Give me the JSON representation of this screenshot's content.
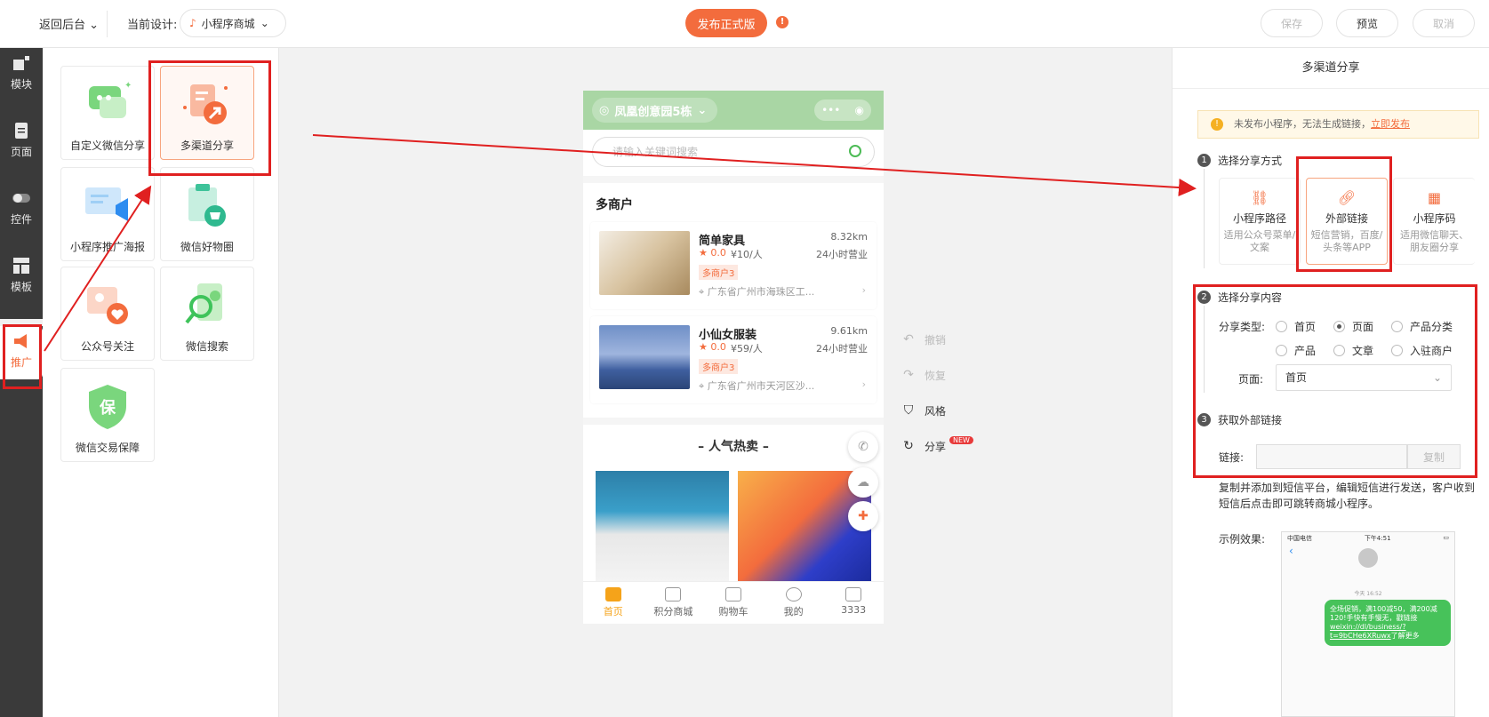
{
  "topbar": {
    "back_label": "返回后台",
    "current_label": "当前设计:",
    "design_name": "小程序商城",
    "publish_label": "发布正式版",
    "warning_icon": "exclamation-icon",
    "save_label": "保存",
    "preview_label": "预览",
    "cancel_label": "取消"
  },
  "rail": {
    "items": [
      {
        "label": "模块",
        "icon": "module-icon"
      },
      {
        "label": "页面",
        "icon": "page-icon"
      },
      {
        "label": "控件",
        "icon": "toggle-icon"
      },
      {
        "label": "模板",
        "icon": "template-icon"
      },
      {
        "label": "推广",
        "icon": "megaphone-icon"
      }
    ]
  },
  "widgets": [
    {
      "label": "自定义微信分享",
      "icon": "wechat-chat-icon"
    },
    {
      "label": "多渠道分享",
      "icon": "share-arrow-icon"
    },
    {
      "label": "小程序推广海报",
      "icon": "poster-icon"
    },
    {
      "label": "微信好物圈",
      "icon": "cart-bag-icon"
    },
    {
      "label": "公众号关注",
      "icon": "heart-follow-icon"
    },
    {
      "label": "微信搜索",
      "icon": "search-icon"
    },
    {
      "label": "微信交易保障",
      "icon": "shield-icon"
    }
  ],
  "phone": {
    "location": "凤凰创意园5栋",
    "search_placeholder": "请输入关键词搜索",
    "section_title": "多商户",
    "shops": [
      {
        "name": "简单家具",
        "distance": "8.32km",
        "rating": "0.0",
        "price": "¥10/人",
        "hours": "24小时营业",
        "tag": "多商户3",
        "address": "广东省广州市海珠区工..."
      },
      {
        "name": "小仙女服装",
        "distance": "9.61km",
        "rating": "0.0",
        "price": "¥59/人",
        "hours": "24小时营业",
        "tag": "多商户3",
        "address": "广东省广州市天河区沙..."
      }
    ],
    "hot_title": "– 人气热卖 –",
    "tabs": [
      {
        "label": "首页"
      },
      {
        "label": "积分商城"
      },
      {
        "label": "购物车"
      },
      {
        "label": "我的"
      },
      {
        "label": "3333"
      }
    ]
  },
  "side_tools": {
    "undo": "撤销",
    "redo": "恢复",
    "style": "风格",
    "share": "分享",
    "new_badge": "NEW"
  },
  "right_panel": {
    "title": "多渠道分享",
    "notice": "未发布小程序，无法生成链接，",
    "notice_link": "立即发布",
    "step1": {
      "num": "1",
      "label": "选择分享方式"
    },
    "methods": [
      {
        "title": "小程序路径",
        "desc": "适用公众号菜单/文案",
        "icon": "path-icon"
      },
      {
        "title": "外部链接",
        "desc": "短信营销，百度/头条等APP",
        "icon": "link-icon"
      },
      {
        "title": "小程序码",
        "desc": "适用微信聊天、朋友圈分享",
        "icon": "qrcode-icon"
      }
    ],
    "step2": {
      "num": "2",
      "label": "选择分享内容"
    },
    "share_type_label": "分享类型:",
    "share_types": [
      {
        "label": "首页",
        "checked": false
      },
      {
        "label": "页面",
        "checked": true
      },
      {
        "label": "产品分类",
        "checked": false
      },
      {
        "label": "产品",
        "checked": false
      },
      {
        "label": "文章",
        "checked": false
      },
      {
        "label": "入驻商户",
        "checked": false
      }
    ],
    "page_label": "页面:",
    "page_value": "首页",
    "step3": {
      "num": "3",
      "label": "获取外部链接"
    },
    "link_label": "链接:",
    "copy_label": "复制",
    "description": "复制并添加到短信平台，编辑短信进行发送，客户收到短信后点击即可跳转商城小程序。",
    "example_label": "示例效果:",
    "sms": {
      "carrier": "中国电信",
      "time": "下午4:51",
      "stamp": "今天 16:52",
      "message": "全场促销，满100减50，满200减120!手快有手慢无，戳链接",
      "message_link": "weixin://dl/business/?t=9bCHe6XRuwx",
      "message_tail": "了解更多"
    }
  },
  "colors": {
    "accent": "#f36c3d",
    "header_green": "#a9d6a4",
    "rail_bg": "#3a3a3a",
    "annotation_red": "#e02020"
  }
}
